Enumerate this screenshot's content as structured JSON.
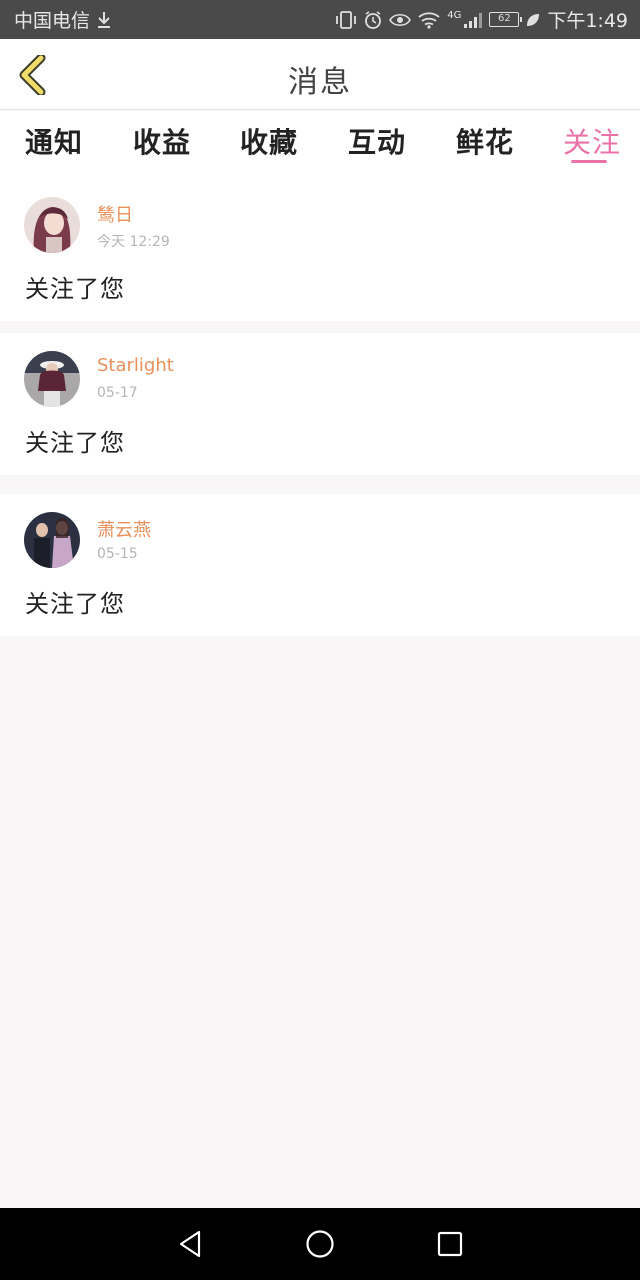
{
  "status_bar": {
    "carrier": "中国电信",
    "network": "4G",
    "battery": "62",
    "time": "下午1:49"
  },
  "header": {
    "title": "消息"
  },
  "tabs": [
    {
      "label": "通知"
    },
    {
      "label": "收益"
    },
    {
      "label": "收藏"
    },
    {
      "label": "互动"
    },
    {
      "label": "鲜花"
    },
    {
      "label": "关注"
    }
  ],
  "active_tab": "关注",
  "feed": [
    {
      "name": "鸶日",
      "time": "今天 12:29",
      "message": "关注了您"
    },
    {
      "name": "Starlight",
      "time": "05-17",
      "message": "关注了您"
    },
    {
      "name": "萧云燕",
      "time": "05-15",
      "message": "关注了您"
    }
  ],
  "colors": {
    "accent_pink": "#e973a8",
    "username_orange": "#e8905a",
    "back_arrow_yellow": "#f0dc6a"
  }
}
